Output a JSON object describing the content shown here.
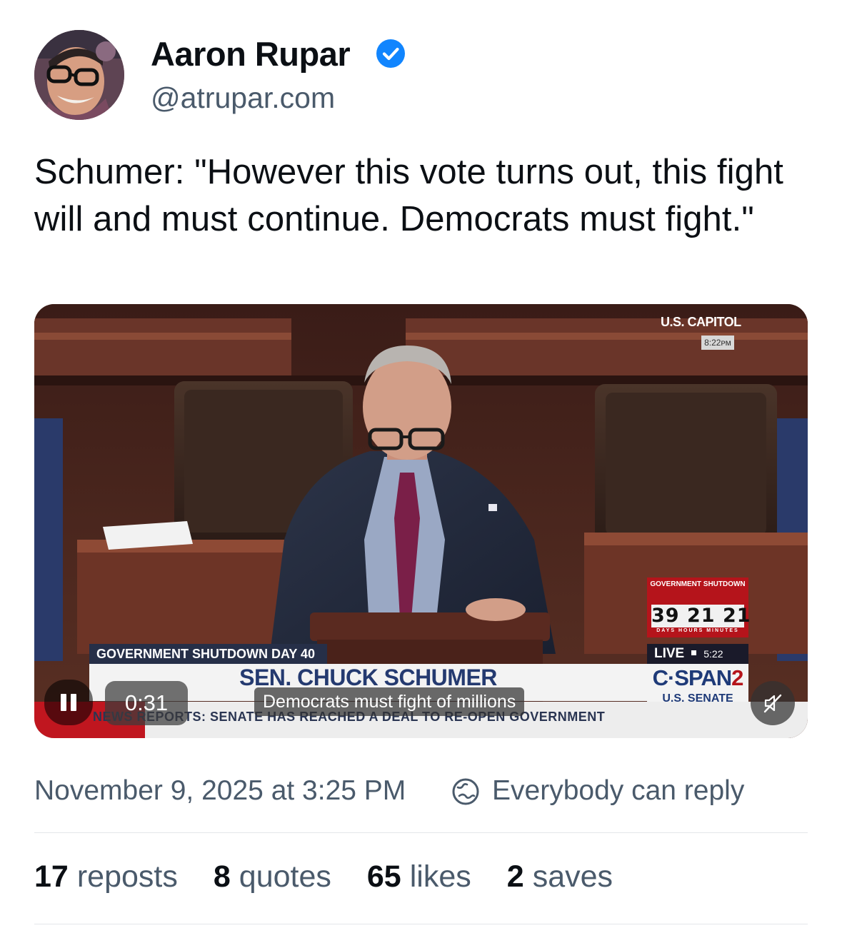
{
  "author": {
    "name": "Aaron Rupar",
    "handle": "@atrupar.com",
    "verified": true,
    "verified_icon": "verified-check-icon",
    "avatar_icon": "avatar-photo"
  },
  "post": {
    "text": "Schumer: \"However this vote turns out, this fight will and must continue. Democrats must fight.\""
  },
  "video": {
    "playback_state": "playing",
    "elapsed": "0:31",
    "caption": "Democrats must fight of millions",
    "muted": true,
    "broadcast": {
      "location": "U.S. CAPITOL",
      "location_time": "8:22ᴘᴍ",
      "shutdown_title": "GOVERNMENT SHUTDOWN",
      "counter": "39 21 21",
      "counter_units": "DAYS HOURS MINUTES",
      "live": "LIVE",
      "live_time": "5:22",
      "lower_third_label": "GOVERNMENT SHUTDOWN DAY 40",
      "speaker": "SEN. CHUCK SCHUMER",
      "network_main": "C·SPAN",
      "network_num": "2",
      "network_sub": "U.S. SENATE",
      "ticker": "NEWS REPORTS: SENATE HAS REACHED A DEAL TO RE-OPEN GOVERNMENT"
    }
  },
  "meta": {
    "date": "November 9, 2025 at 3:25 PM",
    "reply_setting": "Everybody can reply",
    "reply_icon": "globe-icon"
  },
  "stats": {
    "reposts_count": "17",
    "reposts_label": "reposts",
    "quotes_count": "8",
    "quotes_label": "quotes",
    "likes_count": "65",
    "likes_label": "likes",
    "saves_count": "2",
    "saves_label": "saves"
  },
  "colors": {
    "verified_blue": "#1185fe",
    "text_primary": "#0b0f14",
    "text_secondary": "#4a5a6b",
    "broadcast_red": "#b5141b",
    "broadcast_navy": "#243a70"
  }
}
